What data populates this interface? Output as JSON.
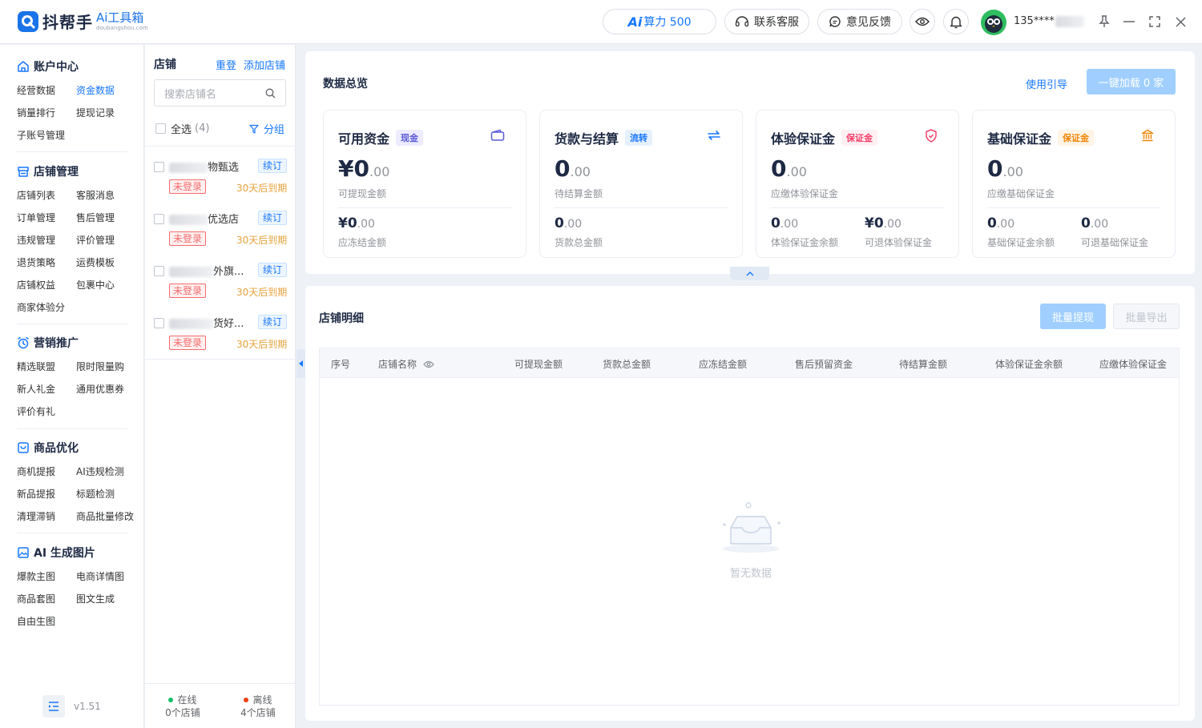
{
  "app": {
    "brand_name": "抖帮手",
    "brand_sub": "Ai工具箱",
    "brand_domain": "doubangshou.com",
    "ai_label": "Ai",
    "ai_power": "算力 500",
    "customer_service": "联系客服",
    "feedback": "意见反馈",
    "user_phone": "135****",
    "version": "v1.51"
  },
  "nav": {
    "sections": [
      {
        "title": "账户中心",
        "items": [
          "经营数据",
          "资金数据",
          "销量排行",
          "提现记录",
          "子账号管理"
        ]
      },
      {
        "title": "店铺管理",
        "items": [
          "店铺列表",
          "客服消息",
          "订单管理",
          "售后管理",
          "违规管理",
          "评价管理",
          "退货策略",
          "运费模板",
          "店铺权益",
          "包裹中心",
          "商家体验分"
        ]
      },
      {
        "title": "营销推广",
        "items": [
          "精选联盟",
          "限时限量购",
          "新人礼金",
          "通用优惠券",
          "评价有礼"
        ]
      },
      {
        "title": "商品优化",
        "items": [
          "商机提报",
          "AI违规检测",
          "新品提报",
          "标题检测",
          "清理滞销",
          "商品批量修改"
        ]
      },
      {
        "title": "AI 生成图片",
        "items": [
          "爆款主图",
          "电商详情图",
          "商品套图",
          "图文生成",
          "自由生图"
        ]
      }
    ],
    "active_item": "资金数据"
  },
  "shops": {
    "title": "店铺",
    "reset": "重登",
    "add": "添加店铺",
    "search_placeholder": "搜索店铺名",
    "select_all": "全选",
    "select_count": "(4)",
    "group": "分组",
    "renew_label": "续订",
    "not_logged_label": "未登录",
    "list": [
      {
        "name_visible": "物甄选",
        "expire": "30天后到期"
      },
      {
        "name_visible": "优选店",
        "expire": "30天后到期"
      },
      {
        "name_visible": "外旗...",
        "expire": "30天后到期"
      },
      {
        "name_visible": "货好...",
        "expire": "30天后到期"
      }
    ],
    "online_label": "在线",
    "online_count": "0个店铺",
    "offline_label": "离线",
    "offline_count": "4个店铺"
  },
  "overview": {
    "title": "数据总览",
    "guide": "使用引导",
    "load_all": "一键加载 0 家",
    "cards": [
      {
        "title": "可用资金",
        "tag": "现金",
        "tag_color": "#5b5bd6",
        "tag_bg": "#ecebff",
        "icon": "wallet-icon",
        "big_int": "¥0",
        "big_dec": ".00",
        "sub": "可提现金额",
        "items": [
          {
            "int": "¥0",
            "dec": ".00",
            "label": "应冻结金额"
          }
        ]
      },
      {
        "title": "货款与结算",
        "tag": "流转",
        "tag_color": "#1677ff",
        "tag_bg": "#e6f1ff",
        "icon": "exchange-icon",
        "big_int": "0",
        "big_dec": ".00",
        "sub": "待结算金额",
        "items": [
          {
            "int": "0",
            "dec": ".00",
            "label": "货款总金额"
          }
        ]
      },
      {
        "title": "体验保证金",
        "tag": "保证金",
        "tag_color": "#f5426c",
        "tag_bg": "#fff0f3",
        "icon": "shield-icon",
        "big_int": "0",
        "big_dec": ".00",
        "sub": "应缴体验保证金",
        "items": [
          {
            "int": "0",
            "dec": ".00",
            "label": "体验保证金余额"
          },
          {
            "int": "¥0",
            "dec": ".00",
            "label": "可退体验保证金"
          }
        ]
      },
      {
        "title": "基础保证金",
        "tag": "保证金",
        "tag_color": "#f0860a",
        "tag_bg": "#fff4e6",
        "icon": "bank-icon",
        "big_int": "0",
        "big_dec": ".00",
        "sub": "应缴基础保证金",
        "items": [
          {
            "int": "0",
            "dec": ".00",
            "label": "基础保证金余额"
          },
          {
            "int": "0",
            "dec": ".00",
            "label": "可退基础保证金"
          }
        ]
      }
    ]
  },
  "detail": {
    "title": "店铺明细",
    "batch_withdraw": "批量提现",
    "batch_export": "批量导出",
    "columns": [
      "序号",
      "店铺名称",
      "可提现金额",
      "货款总金额",
      "应冻结金额",
      "售后预留资金",
      "待结算金额",
      "体验保证金余额",
      "应缴体验保证金"
    ],
    "empty_text": "暂无数据"
  },
  "colors": {
    "primary": "#1677ff",
    "danger": "#f56c6c",
    "warning": "#e6a23c",
    "online": "#19be6b",
    "offline": "#ed4014"
  }
}
